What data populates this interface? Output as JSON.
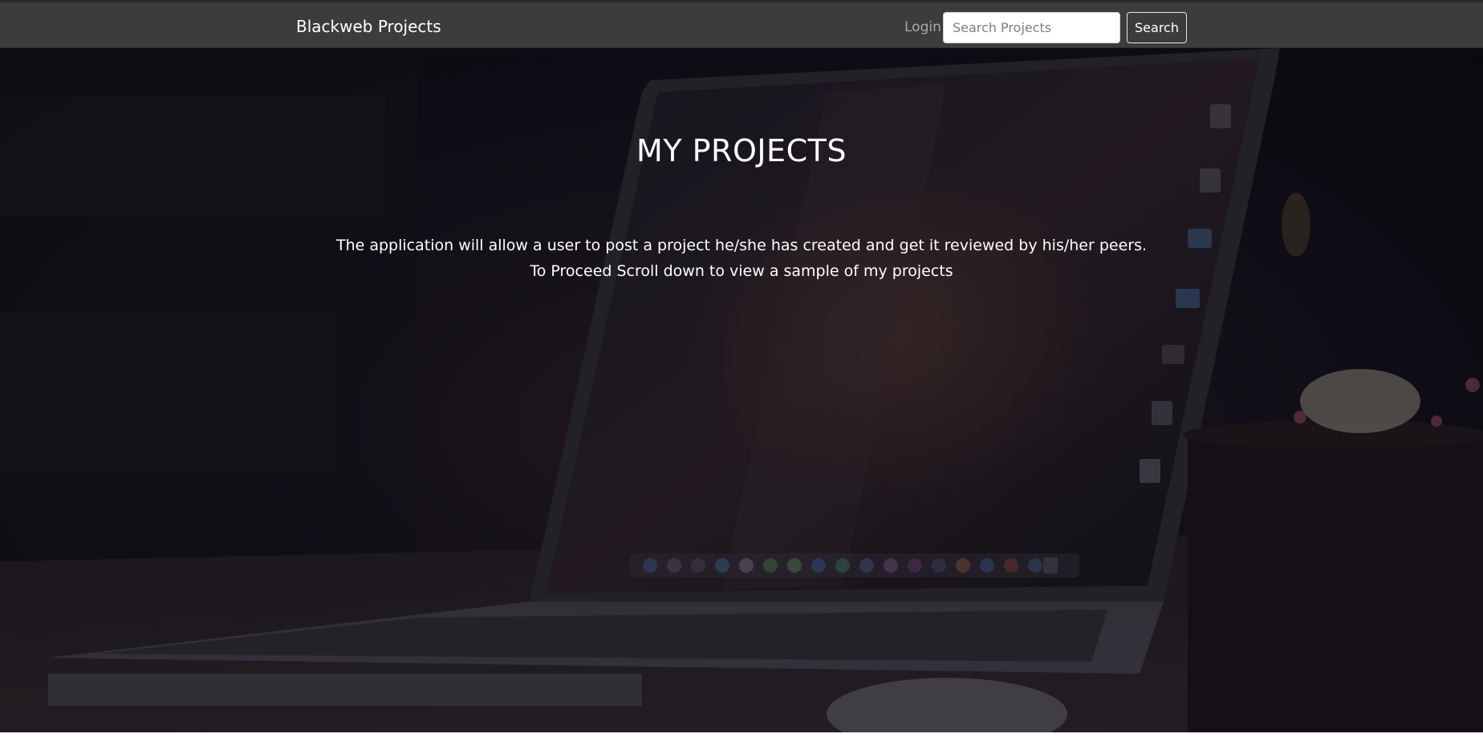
{
  "navbar": {
    "brand": "Blackweb Projects",
    "login_label": "Login",
    "search_placeholder": "Search Projects",
    "search_button_label": "Search"
  },
  "hero": {
    "title": "MY PROJECTS",
    "line1": "The application will allow a user to post a project he/she has created and get it reviewed by his/her peers.",
    "line2": "To Proceed Scroll down to view a sample of my projects"
  },
  "colors": {
    "navbar_bg": "#3c3c3c",
    "hero_text": "#ffffff",
    "login_text": "#a9a9a9"
  }
}
